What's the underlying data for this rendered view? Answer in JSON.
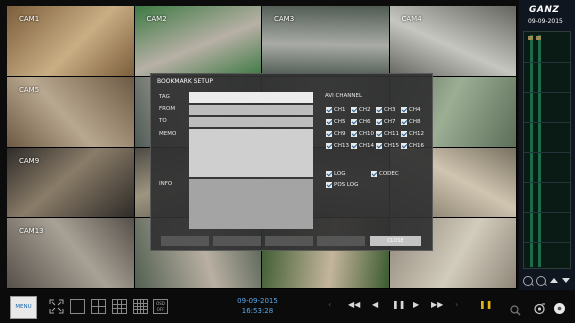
{
  "cameras": [
    {
      "label": "CAM1",
      "colors": [
        "#7c5e3c",
        "#c9ae84"
      ]
    },
    {
      "label": "CAM2",
      "colors": [
        "#3d7a43",
        "#b8b0a6"
      ]
    },
    {
      "label": "CAM3",
      "colors": [
        "#4f5b52",
        "#a9aba6"
      ]
    },
    {
      "label": "CAM4",
      "colors": [
        "#65655f",
        "#c6c6c0"
      ]
    },
    {
      "label": "CAM5",
      "colors": [
        "#6e5a44",
        "#b9a890"
      ]
    },
    {
      "label": "",
      "colors": [
        "#4e5a55",
        "#a7a39a"
      ]
    },
    {
      "label": "",
      "colors": [
        "#5f6661",
        "#9aa096"
      ]
    },
    {
      "label": "",
      "colors": [
        "#5d6e59",
        "#9cae94"
      ]
    },
    {
      "label": "CAM9",
      "colors": [
        "#2e2b28",
        "#8a7c68"
      ]
    },
    {
      "label": "",
      "colors": [
        "#4d4a44",
        "#9e957f"
      ]
    },
    {
      "label": "",
      "colors": [
        "#5b5c55",
        "#a0a097"
      ]
    },
    {
      "label": "",
      "colors": [
        "#7a7060",
        "#cfc5b1"
      ]
    },
    {
      "label": "CAM13",
      "colors": [
        "#56504a",
        "#a8a296"
      ]
    },
    {
      "label": "",
      "colors": [
        "#526052",
        "#b9b0a2"
      ]
    },
    {
      "label": "",
      "colors": [
        "#3b5a2f",
        "#c4b59c"
      ]
    },
    {
      "label": "",
      "colors": [
        "#8f8678",
        "#d2ccbd"
      ]
    }
  ],
  "right_panel": {
    "logo": "GANZ",
    "date": "09-09-2015"
  },
  "dialog": {
    "title": "BOOKMARK SETUP",
    "labels": {
      "tag": "TAG",
      "from": "FROM",
      "to": "TO",
      "memo": "MEMO",
      "info": "INFO"
    },
    "avi_title": "AVI CHANNEL",
    "channels": [
      "CH1",
      "CH2",
      "CH3",
      "CH4",
      "CH5",
      "CH6",
      "CH7",
      "CH8",
      "CH9",
      "CH10",
      "CH11",
      "CH12",
      "CH13",
      "CH14",
      "CH15",
      "CH16"
    ],
    "options": {
      "log": "LOG",
      "codec": "CODEC",
      "pos_log": "POS LOG"
    },
    "buttons": {
      "close": "CLOSE"
    }
  },
  "bottom": {
    "menu_label": "MENU",
    "osd_top": "OSD",
    "osd_bottom": "OFF",
    "date": "09-09-2015",
    "time": "16:53:28",
    "accent": "#5aa9ea",
    "pause_color": "#e2b51a"
  },
  "icons": {
    "fullscreen": "fullscreen-icon",
    "layout_1": "single-view-icon",
    "layout_4": "quad-view-icon",
    "layout_9": "nine-view-icon",
    "layout_16": "sixteen-view-icon",
    "rewind_fast": "fast-rewind-icon",
    "step_back": "step-back-icon",
    "pause": "pause-icon",
    "step_fwd": "step-forward-icon",
    "ffwd": "fast-forward-icon",
    "search": "search-icon",
    "snapshot": "camera-icon",
    "disc": "disc-icon"
  }
}
